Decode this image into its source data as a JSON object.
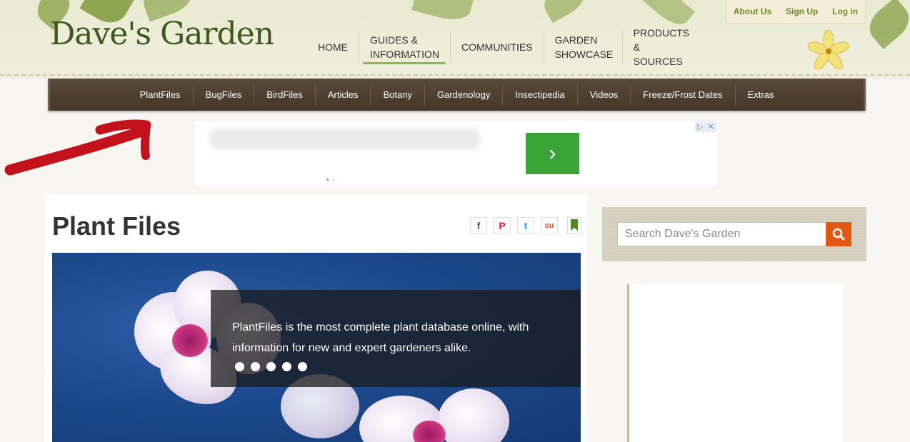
{
  "site": {
    "logo": "Dave's Garden"
  },
  "top_links": [
    {
      "label": "About Us"
    },
    {
      "label": "Sign Up"
    },
    {
      "label": "Log in"
    }
  ],
  "main_nav": [
    {
      "label": "HOME"
    },
    {
      "label": "GUIDES & INFORMATION"
    },
    {
      "label": "COMMUNITIES"
    },
    {
      "label": "GARDEN SHOWCASE"
    },
    {
      "label": "PRODUCTS & SOURCES"
    }
  ],
  "sub_nav": [
    {
      "label": "PlantFiles"
    },
    {
      "label": "BugFiles"
    },
    {
      "label": "BirdFiles"
    },
    {
      "label": "Articles"
    },
    {
      "label": "Botany"
    },
    {
      "label": "Gardenology"
    },
    {
      "label": "Insectipedia"
    },
    {
      "label": "Videos"
    },
    {
      "label": "Freeze/Frost Dates"
    },
    {
      "label": "Extras"
    }
  ],
  "ad": {
    "button_glyph": "›",
    "adchoice_glyphs": [
      "▷",
      "✕"
    ]
  },
  "main": {
    "title": "Plant Files",
    "social": [
      {
        "icon": "facebook-icon",
        "glyph": "f",
        "color": "#3b5998"
      },
      {
        "icon": "pinterest-icon",
        "glyph": "P",
        "color": "#cb2027"
      },
      {
        "icon": "twitter-icon",
        "glyph": "t",
        "color": "#1da1f2"
      },
      {
        "icon": "stumbleupon-icon",
        "glyph": "su",
        "color": "#eb4924"
      }
    ],
    "hero": {
      "caption": "PlantFiles is the most complete plant database online, with information for new and expert gardeners alike.",
      "slide_count": 5
    }
  },
  "sidebar": {
    "search": {
      "placeholder": "Search Dave's Garden"
    }
  },
  "colors": {
    "accent_green": "#6f8a22",
    "subnav_bg": "#4f4032",
    "search_button": "#e05a14",
    "ad_button": "#3aa33a"
  }
}
